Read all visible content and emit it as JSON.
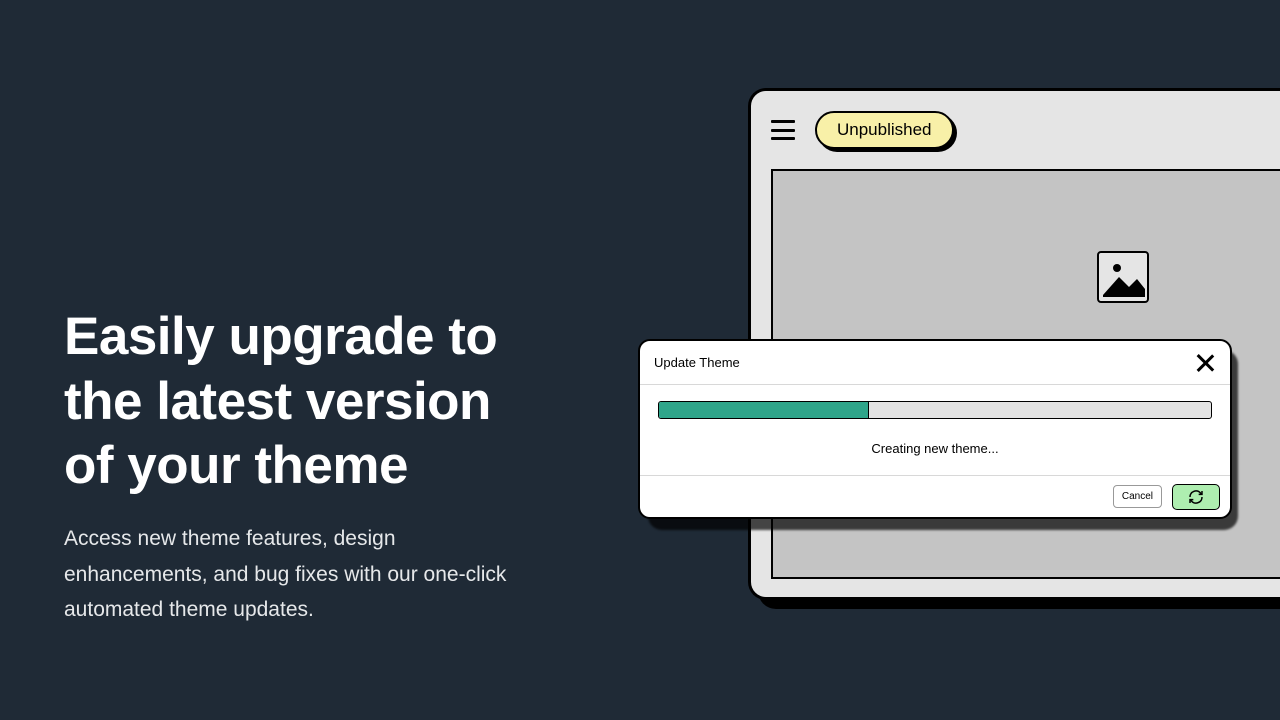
{
  "marketing": {
    "heading": "Easily upgrade to the latest version of your theme",
    "subheading": "Access new theme features, design enhancements, and bug fixes with our one-click automated theme updates."
  },
  "app": {
    "status_label": "Unpublished"
  },
  "modal": {
    "title": "Update Theme",
    "progress_percent": 38,
    "status_text": "Creating new theme...",
    "cancel_label": "Cancel"
  },
  "colors": {
    "background": "#1f2a36",
    "pill_bg": "#f8f0a8",
    "progress_fill": "#2fa58a",
    "refresh_bg": "#aeeeb0"
  }
}
